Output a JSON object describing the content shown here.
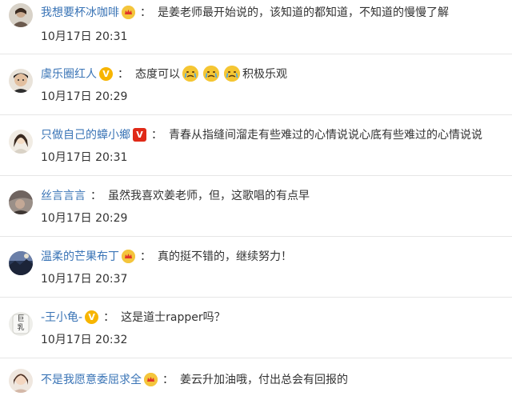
{
  "comments": [
    {
      "username": "我想要杯冰咖啡",
      "badge": "crown",
      "colon": "：",
      "text": "是姜老师最开始说的，该知道的都知道，不知道的慢慢了解",
      "time": "10月17日 20:31"
    },
    {
      "username": "虞乐圈红人",
      "badge": "gold-v",
      "badge_text": "V",
      "colon": "：",
      "text_before": "态度可以",
      "text_after": "积极乐观",
      "emoji_count": 3,
      "time": "10月17日 20:29"
    },
    {
      "username": "只做自己的蟑小鄉",
      "badge": "red-v",
      "badge_text": "V",
      "colon": "：",
      "text": "青春从指缝间溜走有些难过的心情说说心底有些难过的心情说说",
      "time": "10月17日 20:31"
    },
    {
      "username": "丝言言言",
      "colon": "：",
      "text": "虽然我喜欢姜老师，但，这歌唱的有点早",
      "time": "10月17日 20:29"
    },
    {
      "username": "温柔的芒果布丁",
      "badge": "crown",
      "colon": "：",
      "text": "真的挺不错的，继续努力！",
      "time": "10月17日 20:37"
    },
    {
      "username": "-王小龟-",
      "badge": "gold-v",
      "badge_text": "V",
      "colon": "：",
      "text": "这是道士rapper吗？",
      "time": "10月17日 20:32"
    },
    {
      "username": "不是我愿意委屈求全",
      "badge": "crown",
      "colon": "：",
      "text": "姜云升加油哦，付出总会有回报的"
    }
  ],
  "avatar_texts": {
    "c6": "巨\n乳"
  },
  "colors": {
    "link": "#3a74b6",
    "text": "#333333",
    "divider": "#e6e6e6",
    "gold": "#f7b500",
    "red": "#e02a18"
  }
}
